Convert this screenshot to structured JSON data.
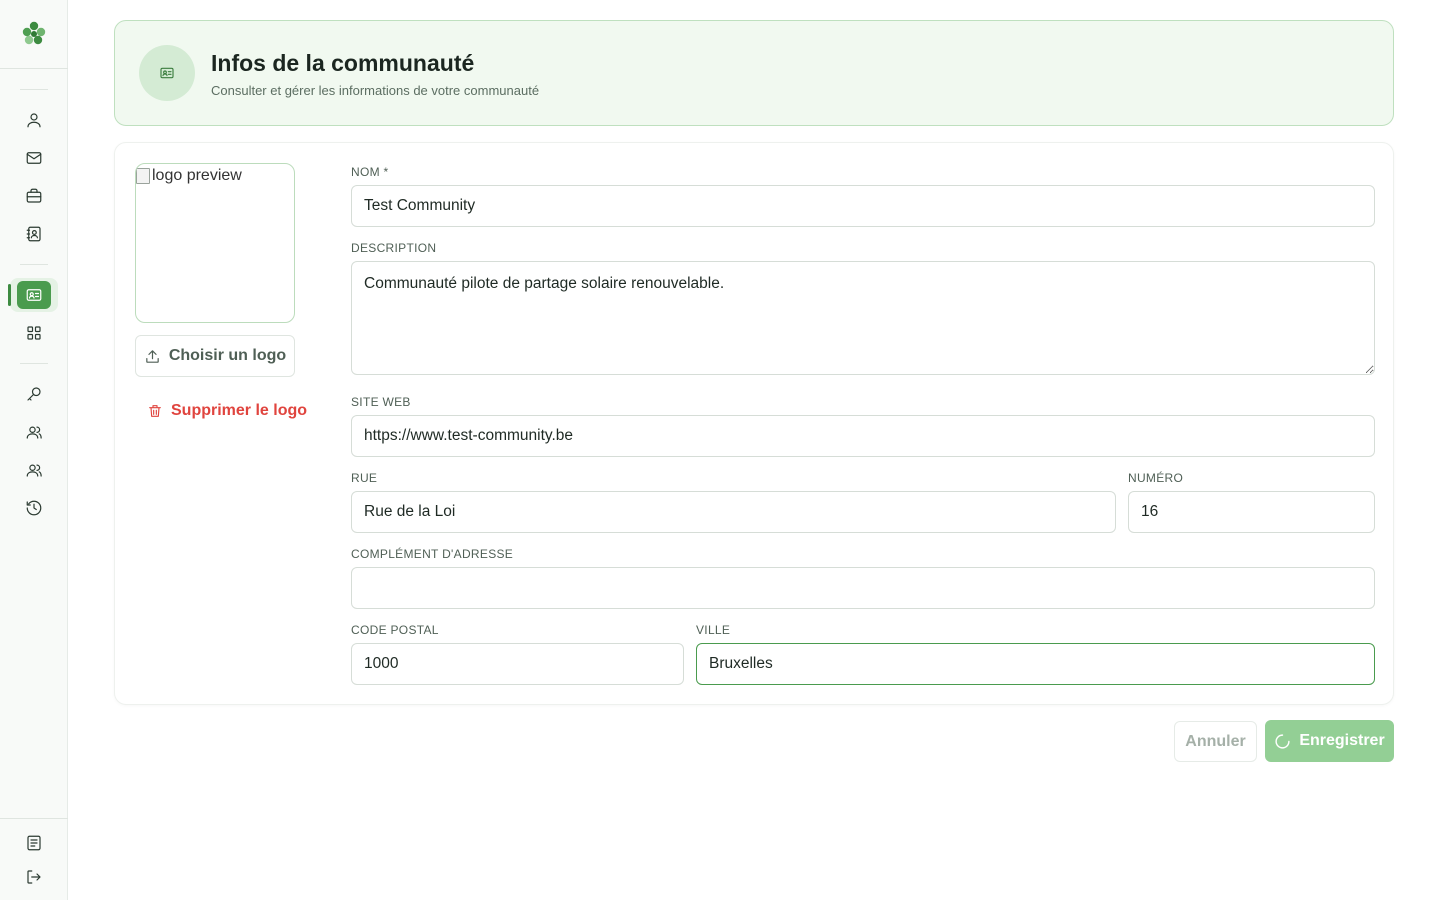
{
  "sidebar": {
    "logo": "clover-logo-icon",
    "items": [
      {
        "icon": "user-icon"
      },
      {
        "icon": "mail-icon"
      },
      {
        "icon": "briefcase-icon"
      },
      {
        "icon": "contact-book-icon"
      },
      {
        "icon": "id-card-icon",
        "active": true
      },
      {
        "icon": "grid-icon"
      },
      {
        "icon": "key-icon"
      },
      {
        "icon": "users-icon"
      },
      {
        "icon": "users-alt-icon"
      },
      {
        "icon": "history-icon"
      },
      {
        "icon": "document-icon"
      },
      {
        "icon": "logout-icon"
      }
    ]
  },
  "header": {
    "title": "Infos de la communauté",
    "subtitle": "Consulter et gérer les informations de votre communauté"
  },
  "logo": {
    "preview_alt": "logo preview",
    "choose_label": "Choisir un logo",
    "delete_label": "Supprimer le logo"
  },
  "form": {
    "nom": {
      "label": "NOM *",
      "value": "Test Community"
    },
    "description": {
      "label": "DESCRIPTION",
      "value": "Communauté pilote de partage solaire renouvelable."
    },
    "site_web": {
      "label": "SITE WEB",
      "value": "https://www.test-community.be"
    },
    "rue": {
      "label": "RUE",
      "value": "Rue de la Loi"
    },
    "numero": {
      "label": "NUMÉRO",
      "value": "16"
    },
    "complement": {
      "label": "COMPLÉMENT D'ADRESSE",
      "value": ""
    },
    "code_postal": {
      "label": "CODE POSTAL",
      "value": "1000"
    },
    "ville": {
      "label": "VILLE",
      "value": "Bruxelles"
    }
  },
  "actions": {
    "cancel_label": "Annuler",
    "save_label": "Enregistrer"
  },
  "colors": {
    "accent": "#4a9b4e",
    "danger": "#e0443e",
    "save_disabled": "#93cf95"
  }
}
